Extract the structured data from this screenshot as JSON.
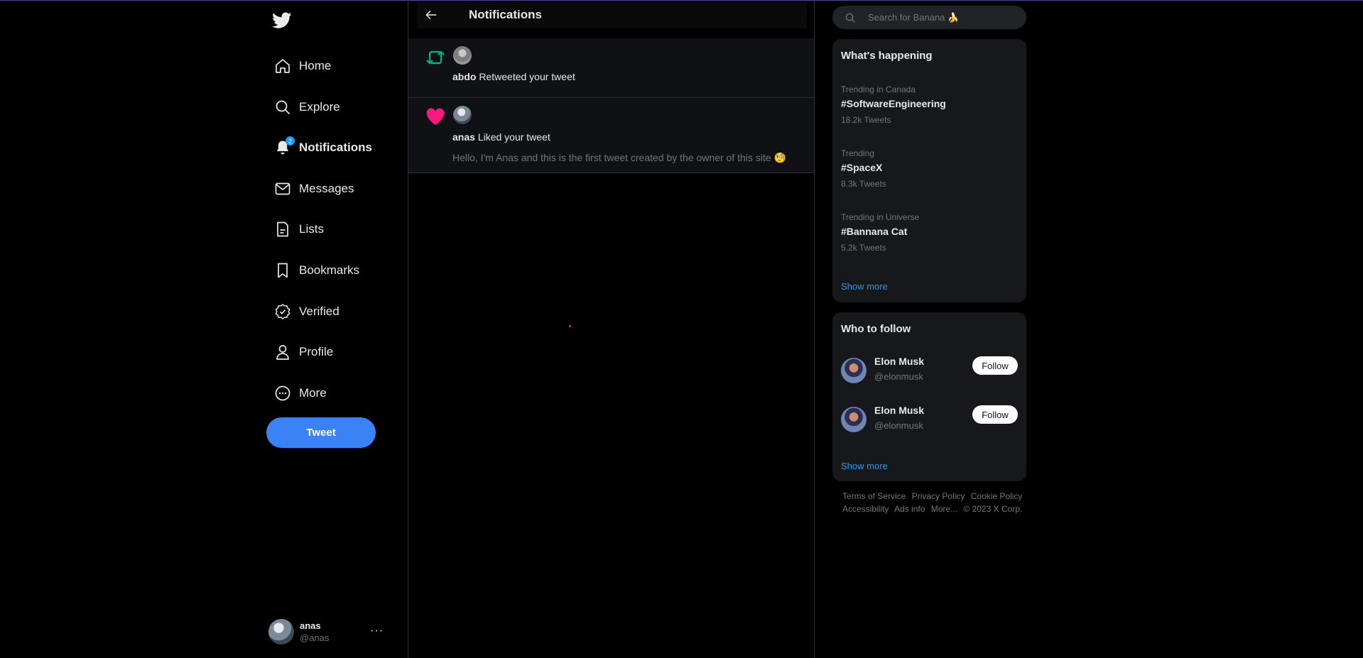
{
  "sidebar": {
    "nav": [
      {
        "label": "Home",
        "icon": "home-icon"
      },
      {
        "label": "Explore",
        "icon": "search-icon"
      },
      {
        "label": "Notifications",
        "icon": "bell-icon",
        "badge": "2"
      },
      {
        "label": "Messages",
        "icon": "envelope-icon"
      },
      {
        "label": "Lists",
        "icon": "list-icon"
      },
      {
        "label": "Bookmarks",
        "icon": "bookmark-icon"
      },
      {
        "label": "Verified",
        "icon": "verified-icon"
      },
      {
        "label": "Profile",
        "icon": "person-icon"
      },
      {
        "label": "More",
        "icon": "more-circle-icon"
      }
    ],
    "tweet_button": "Tweet",
    "account": {
      "name": "anas",
      "handle": "@anas",
      "menu": "···"
    }
  },
  "main": {
    "title": "Notifications",
    "notifications": [
      {
        "type": "retweet",
        "user": "abdo",
        "action": "Retweeted your tweet"
      },
      {
        "type": "like",
        "user": "anas",
        "action": "Liked your tweet",
        "tweet_text": "Hello, I'm Anas and this is the first tweet created by the owner of this site 🧐"
      }
    ]
  },
  "right": {
    "search": {
      "placeholder": "Search for Banana 🍌"
    },
    "trends": {
      "title": "What's happening",
      "items": [
        {
          "context": "Trending in Canada",
          "tag": "#SoftwareEngineering",
          "count": "18.2k Tweets"
        },
        {
          "context": "Trending",
          "tag": "#SpaceX",
          "count": "8.3k Tweets"
        },
        {
          "context": "Trending in Universe",
          "tag": "#Bannana Cat",
          "count": "5.2k Tweets"
        }
      ],
      "show_more": "Show more"
    },
    "who_to_follow": {
      "title": "Who to follow",
      "items": [
        {
          "name": "Elon Musk",
          "handle": "@elonmusk",
          "button": "Follow"
        },
        {
          "name": "Elon Musk",
          "handle": "@elonmusk",
          "button": "Follow"
        }
      ],
      "show_more": "Show more"
    },
    "footer": {
      "links": [
        "Terms of Service",
        "Privacy Policy",
        "Cookie Policy",
        "Accessibility",
        "Ads info",
        "More..."
      ],
      "copyright": "© 2023 X Corp."
    }
  },
  "colors": {
    "accent": "#1d9bf0",
    "tweet_button": "#3b82f6",
    "retweet": "#00ba7c",
    "like": "#f91880"
  }
}
